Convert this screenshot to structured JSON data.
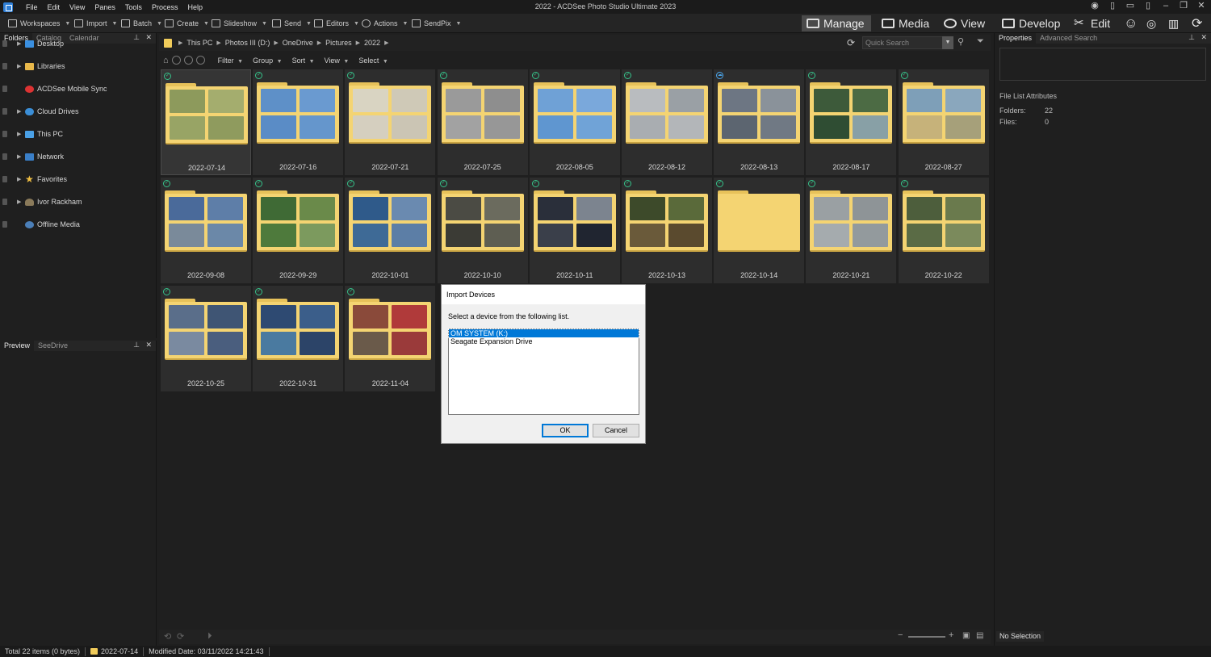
{
  "window": {
    "title": "2022 - ACDSee Photo Studio Ultimate 2023"
  },
  "menu": [
    "File",
    "Edit",
    "View",
    "Panes",
    "Tools",
    "Process",
    "Help"
  ],
  "toolbar": {
    "items": [
      "Workspaces",
      "Import",
      "Batch",
      "Create",
      "Slideshow",
      "Send",
      "Editors",
      "Actions",
      "SendPix"
    ],
    "modes": [
      "Manage",
      "Media",
      "View",
      "Develop",
      "Edit"
    ]
  },
  "folders_panel": {
    "tabs": [
      "Folders",
      "Catalog",
      "Calendar"
    ],
    "items": [
      "Desktop",
      "Libraries",
      "ACDSee Mobile Sync",
      "Cloud Drives",
      "This PC",
      "Network",
      "Favorites",
      "Ivor Rackham",
      "Offline Media"
    ]
  },
  "preview_panel": {
    "tabs": [
      "Preview",
      "SeeDrive"
    ]
  },
  "path": {
    "crumbs": [
      "This PC",
      "Photos III (D:)",
      "OneDrive",
      "Pictures",
      "2022"
    ],
    "search_placeholder": "Quick Search"
  },
  "filterbar": [
    "Filter",
    "Group",
    "Sort",
    "View",
    "Select"
  ],
  "folders": [
    {
      "label": "2022-07-14"
    },
    {
      "label": "2022-07-16"
    },
    {
      "label": "2022-07-21"
    },
    {
      "label": "2022-07-25"
    },
    {
      "label": "2022-08-05"
    },
    {
      "label": "2022-08-12"
    },
    {
      "label": "2022-08-13"
    },
    {
      "label": "2022-08-17"
    },
    {
      "label": "2022-08-27"
    },
    {
      "label": "2022-09-08"
    },
    {
      "label": "2022-09-29"
    },
    {
      "label": "2022-10-01"
    },
    {
      "label": "2022-10-10"
    },
    {
      "label": "2022-10-11"
    },
    {
      "label": "2022-10-13"
    },
    {
      "label": "2022-10-14"
    },
    {
      "label": "2022-10-21"
    },
    {
      "label": "2022-10-22"
    },
    {
      "label": "2022-10-25"
    },
    {
      "label": "2022-10-31"
    },
    {
      "label": "2022-11-04"
    }
  ],
  "dialog": {
    "title": "Import Devices",
    "message": "Select a device from the following list.",
    "devices": [
      "OM SYSTEM (K:)",
      "Seagate Expansion Drive"
    ],
    "ok": "OK",
    "cancel": "Cancel"
  },
  "properties": {
    "tabs": [
      "Properties",
      "Advanced Search"
    ],
    "section": "File List Attributes",
    "folders_label": "Folders:",
    "folders_value": "22",
    "files_label": "Files:",
    "files_value": "0",
    "selection": "No Selection"
  },
  "status": {
    "total": "Total 22 items  (0 bytes)",
    "current": "2022-07-14",
    "modified": "Modified Date: 03/11/2022 14:21:43"
  }
}
